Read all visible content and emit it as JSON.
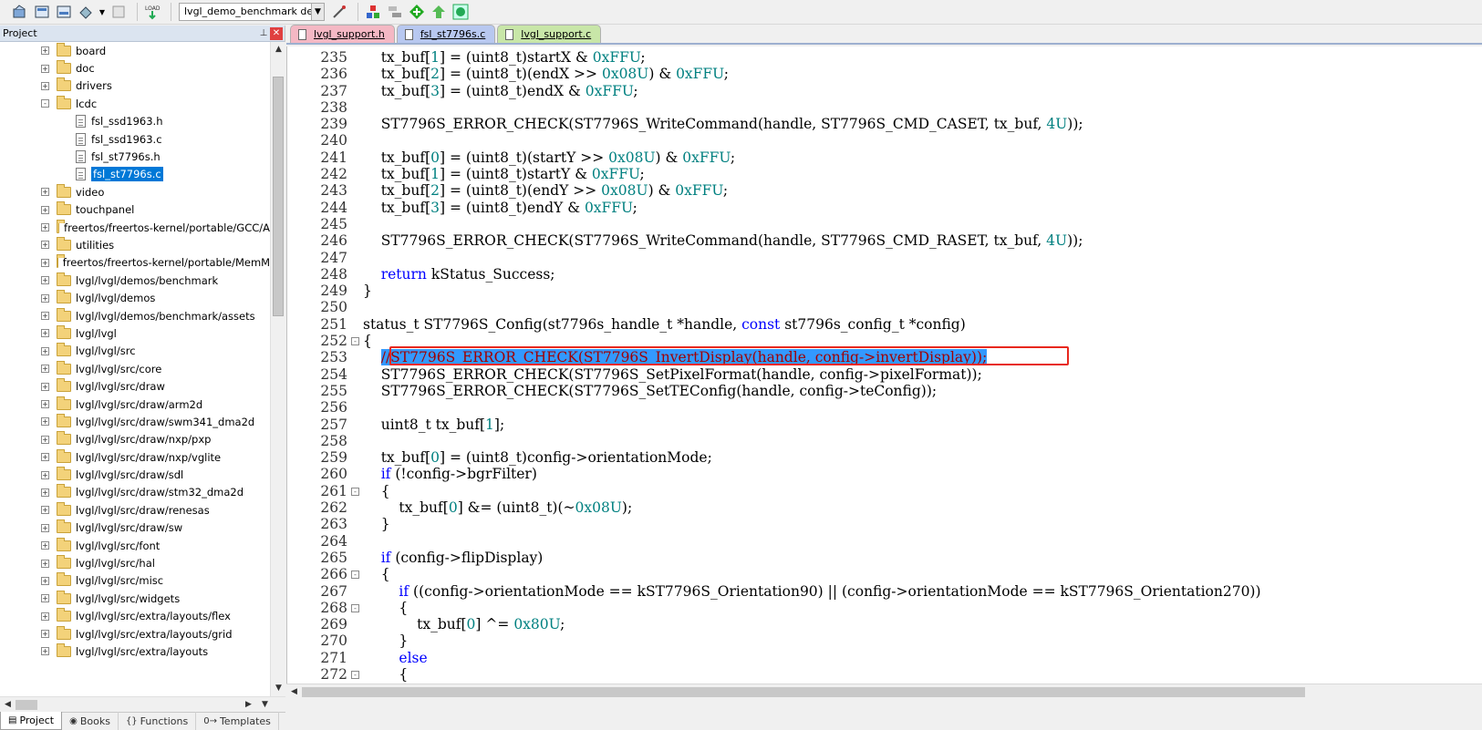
{
  "toolbar": {
    "target_name": "lvgl_demo_benchmark de",
    "icons": [
      "build-icon",
      "rebuild-icon",
      "batch-build-icon",
      "translate-icon",
      "stop-build-icon",
      "load-icon",
      "target-options-icon",
      "manage-components-icon",
      "select-packs-icon",
      "pack-installer-icon",
      "run-icon",
      "options-icon"
    ]
  },
  "project_panel": {
    "title": "Project",
    "tree": [
      {
        "label": "board",
        "type": "folder",
        "expander": "+"
      },
      {
        "label": "doc",
        "type": "folder",
        "expander": "+"
      },
      {
        "label": "drivers",
        "type": "folder",
        "expander": "+"
      },
      {
        "label": "lcdc",
        "type": "folder",
        "expander": "-"
      },
      {
        "label": "fsl_ssd1963.h",
        "type": "file"
      },
      {
        "label": "fsl_ssd1963.c",
        "type": "file"
      },
      {
        "label": "fsl_st7796s.h",
        "type": "file"
      },
      {
        "label": "fsl_st7796s.c",
        "type": "file",
        "selected": true
      },
      {
        "label": "video",
        "type": "folder",
        "expander": "+"
      },
      {
        "label": "touchpanel",
        "type": "folder",
        "expander": "+"
      },
      {
        "label": "freertos/freertos-kernel/portable/GCC/A",
        "type": "folder",
        "expander": "+"
      },
      {
        "label": "utilities",
        "type": "folder",
        "expander": "+"
      },
      {
        "label": "freertos/freertos-kernel/portable/MemM",
        "type": "folder",
        "expander": "+"
      },
      {
        "label": "lvgl/lvgl/demos/benchmark",
        "type": "folder",
        "expander": "+"
      },
      {
        "label": "lvgl/lvgl/demos",
        "type": "folder",
        "expander": "+"
      },
      {
        "label": "lvgl/lvgl/demos/benchmark/assets",
        "type": "folder",
        "expander": "+"
      },
      {
        "label": "lvgl/lvgl",
        "type": "folder",
        "expander": "+"
      },
      {
        "label": "lvgl/lvgl/src",
        "type": "folder",
        "expander": "+"
      },
      {
        "label": "lvgl/lvgl/src/core",
        "type": "folder",
        "expander": "+"
      },
      {
        "label": "lvgl/lvgl/src/draw",
        "type": "folder",
        "expander": "+"
      },
      {
        "label": "lvgl/lvgl/src/draw/arm2d",
        "type": "folder",
        "expander": "+"
      },
      {
        "label": "lvgl/lvgl/src/draw/swm341_dma2d",
        "type": "folder",
        "expander": "+"
      },
      {
        "label": "lvgl/lvgl/src/draw/nxp/pxp",
        "type": "folder",
        "expander": "+"
      },
      {
        "label": "lvgl/lvgl/src/draw/nxp/vglite",
        "type": "folder",
        "expander": "+"
      },
      {
        "label": "lvgl/lvgl/src/draw/sdl",
        "type": "folder",
        "expander": "+"
      },
      {
        "label": "lvgl/lvgl/src/draw/stm32_dma2d",
        "type": "folder",
        "expander": "+"
      },
      {
        "label": "lvgl/lvgl/src/draw/renesas",
        "type": "folder",
        "expander": "+"
      },
      {
        "label": "lvgl/lvgl/src/draw/sw",
        "type": "folder",
        "expander": "+"
      },
      {
        "label": "lvgl/lvgl/src/font",
        "type": "folder",
        "expander": "+"
      },
      {
        "label": "lvgl/lvgl/src/hal",
        "type": "folder",
        "expander": "+"
      },
      {
        "label": "lvgl/lvgl/src/misc",
        "type": "folder",
        "expander": "+"
      },
      {
        "label": "lvgl/lvgl/src/widgets",
        "type": "folder",
        "expander": "+"
      },
      {
        "label": "lvgl/lvgl/src/extra/layouts/flex",
        "type": "folder",
        "expander": "+"
      },
      {
        "label": "lvgl/lvgl/src/extra/layouts/grid",
        "type": "folder",
        "expander": "+"
      },
      {
        "label": "lvgl/lvgl/src/extra/layouts",
        "type": "folder",
        "expander": "+"
      }
    ],
    "bottom_tabs": [
      {
        "label": "Project",
        "active": true
      },
      {
        "label": "Books",
        "active": false
      },
      {
        "label": "Functions",
        "active": false
      },
      {
        "label": "Templates",
        "active": false
      }
    ]
  },
  "editor": {
    "tabs": [
      {
        "label": "lvgl_support.h",
        "color": "pink"
      },
      {
        "label": "fsl_st7796s.c",
        "color": "blue",
        "active": true
      },
      {
        "label": "lvgl_support.c",
        "color": "green"
      }
    ],
    "lines": [
      {
        "n": "235",
        "fold": "",
        "html": "    tx_buf[<span class=\"num\">1</span>] = (uint8_t)startX &amp; <span class=\"num\">0xFFU</span>;"
      },
      {
        "n": "236",
        "fold": "",
        "html": "    tx_buf[<span class=\"num\">2</span>] = (uint8_t)(endX &gt;&gt; <span class=\"num\">0x08U</span>) &amp; <span class=\"num\">0xFFU</span>;"
      },
      {
        "n": "237",
        "fold": "",
        "html": "    tx_buf[<span class=\"num\">3</span>] = (uint8_t)endX &amp; <span class=\"num\">0xFFU</span>;"
      },
      {
        "n": "238",
        "fold": "",
        "html": ""
      },
      {
        "n": "239",
        "fold": "",
        "html": "    ST7796S_ERROR_CHECK(ST7796S_WriteCommand(handle, ST7796S_CMD_CASET, tx_buf, <span class=\"num\">4U</span>));"
      },
      {
        "n": "240",
        "fold": "",
        "html": ""
      },
      {
        "n": "241",
        "fold": "",
        "html": "    tx_buf[<span class=\"num\">0</span>] = (uint8_t)(startY &gt;&gt; <span class=\"num\">0x08U</span>) &amp; <span class=\"num\">0xFFU</span>;"
      },
      {
        "n": "242",
        "fold": "",
        "html": "    tx_buf[<span class=\"num\">1</span>] = (uint8_t)startY &amp; <span class=\"num\">0xFFU</span>;"
      },
      {
        "n": "243",
        "fold": "",
        "html": "    tx_buf[<span class=\"num\">2</span>] = (uint8_t)(endY &gt;&gt; <span class=\"num\">0x08U</span>) &amp; <span class=\"num\">0xFFU</span>;"
      },
      {
        "n": "244",
        "fold": "",
        "html": "    tx_buf[<span class=\"num\">3</span>] = (uint8_t)endY &amp; <span class=\"num\">0xFFU</span>;"
      },
      {
        "n": "245",
        "fold": "",
        "html": ""
      },
      {
        "n": "246",
        "fold": "",
        "html": "    ST7796S_ERROR_CHECK(ST7796S_WriteCommand(handle, ST7796S_CMD_RASET, tx_buf, <span class=\"num\">4U</span>));"
      },
      {
        "n": "247",
        "fold": "",
        "html": ""
      },
      {
        "n": "248",
        "fold": "",
        "html": "    <span class=\"kw\">return</span> kStatus_Success;"
      },
      {
        "n": "249",
        "fold": "",
        "html": "}"
      },
      {
        "n": "250",
        "fold": "",
        "html": ""
      },
      {
        "n": "251",
        "fold": "",
        "html": "status_t ST7796S_Config(st7796s_handle_t *handle, <span class=\"kw\">const</span> st7796s_config_t *config)"
      },
      {
        "n": "252",
        "fold": "-",
        "html": "{"
      },
      {
        "n": "253",
        "fold": "",
        "html": "    <span class=\"hl\">//ST7796S_ERROR_CHECK(ST7796S_InvertDisplay(handle, config-&gt;invertDisplay));</span>"
      },
      {
        "n": "254",
        "fold": "",
        "html": "    ST7796S_ERROR_CHECK(ST7796S_SetPixelFormat(handle, config-&gt;pixelFormat));"
      },
      {
        "n": "255",
        "fold": "",
        "html": "    ST7796S_ERROR_CHECK(ST7796S_SetTEConfig(handle, config-&gt;teConfig));"
      },
      {
        "n": "256",
        "fold": "",
        "html": ""
      },
      {
        "n": "257",
        "fold": "",
        "html": "    uint8_t tx_buf[<span class=\"num\">1</span>];"
      },
      {
        "n": "258",
        "fold": "",
        "html": ""
      },
      {
        "n": "259",
        "fold": "",
        "html": "    tx_buf[<span class=\"num\">0</span>] = (uint8_t)config-&gt;orientationMode;"
      },
      {
        "n": "260",
        "fold": "",
        "html": "    <span class=\"kw\">if</span> (!config-&gt;bgrFilter)"
      },
      {
        "n": "261",
        "fold": "-",
        "html": "    {"
      },
      {
        "n": "262",
        "fold": "",
        "html": "        tx_buf[<span class=\"num\">0</span>] &amp;= (uint8_t)(~<span class=\"num\">0x08U</span>);"
      },
      {
        "n": "263",
        "fold": "",
        "html": "    }"
      },
      {
        "n": "264",
        "fold": "",
        "html": ""
      },
      {
        "n": "265",
        "fold": "",
        "html": "    <span class=\"kw\">if</span> (config-&gt;flipDisplay)"
      },
      {
        "n": "266",
        "fold": "-",
        "html": "    {"
      },
      {
        "n": "267",
        "fold": "",
        "html": "        <span class=\"kw\">if</span> ((config-&gt;orientationMode == kST7796S_Orientation90) || (config-&gt;orientationMode == kST7796S_Orientation270))"
      },
      {
        "n": "268",
        "fold": "-",
        "html": "        {"
      },
      {
        "n": "269",
        "fold": "",
        "html": "            tx_buf[<span class=\"num\">0</span>] ^= <span class=\"num\">0x80U</span>;"
      },
      {
        "n": "270",
        "fold": "",
        "html": "        }"
      },
      {
        "n": "271",
        "fold": "",
        "html": "        <span class=\"kw\">else</span>"
      },
      {
        "n": "272",
        "fold": "-",
        "html": "        {"
      }
    ]
  }
}
